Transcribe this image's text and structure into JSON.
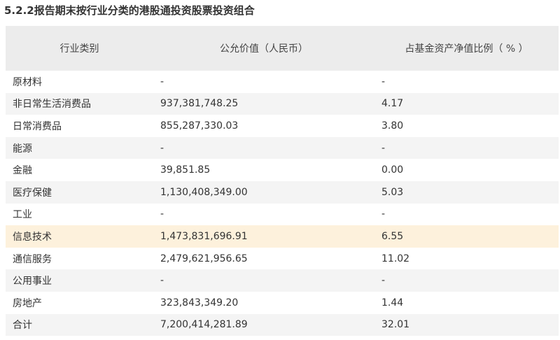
{
  "title": "5.2.2报告期末按行业分类的港股通投资股票投资组合",
  "table": {
    "headers": [
      "行业类别",
      "公允价值（人民币）",
      "占基金资产净值比例（ % ）"
    ],
    "rows": [
      [
        "原材料",
        "-",
        "-"
      ],
      [
        "非日常生活消费品",
        "937,381,748.25",
        "4.17"
      ],
      [
        "日常消费品",
        "855,287,330.03",
        "3.80"
      ],
      [
        "能源",
        "-",
        "-"
      ],
      [
        "金融",
        "39,851.85",
        "0.00"
      ],
      [
        "医疗保健",
        "1,130,408,349.00",
        "5.03"
      ],
      [
        "工业",
        "-",
        "-"
      ],
      [
        "信息技术",
        "1,473,831,696.91",
        "6.55"
      ],
      [
        "通信服务",
        "2,479,621,956.65",
        "11.02"
      ],
      [
        "公用事业",
        "-",
        "-"
      ],
      [
        "房地产",
        "323,843,349.20",
        "1.44"
      ],
      [
        "合计",
        "7,200,414,281.89",
        "32.01"
      ]
    ],
    "highlight_row": 7,
    "highlight_color": "#fdf1dc"
  },
  "icons": {
    "copy": "copy-icon"
  }
}
